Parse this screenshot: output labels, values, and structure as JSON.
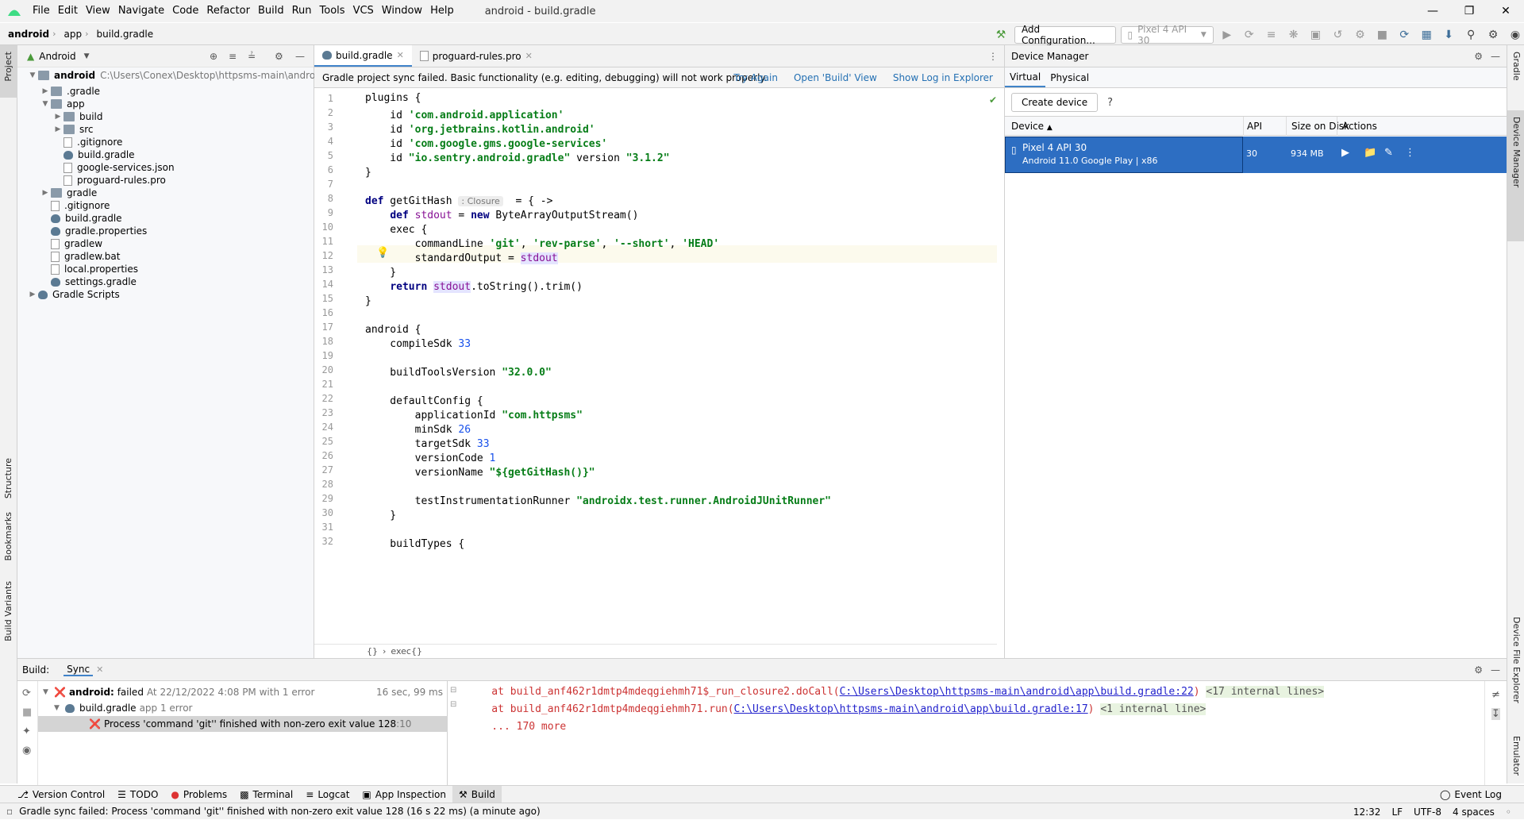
{
  "menubar": {
    "items": [
      "File",
      "Edit",
      "View",
      "Navigate",
      "Code",
      "Refactor",
      "Build",
      "Run",
      "Tools",
      "VCS",
      "Window",
      "Help"
    ],
    "window_title": "android - build.gradle"
  },
  "navbar": {
    "crumbs": [
      "android",
      "app",
      "build.gradle"
    ],
    "add_config": "Add Configuration...",
    "device_selector": "Pixel 4 API 30"
  },
  "project": {
    "view_label": "Android",
    "root_name": "android",
    "root_path": "C:\\Users\\Conex\\Desktop\\httpsms-main\\android",
    "items": [
      ".gradle",
      "app",
      "build",
      "src",
      ".gitignore",
      "build.gradle",
      "google-services.json",
      "proguard-rules.pro",
      "gradle",
      ".gitignore",
      "build.gradle",
      "gradle.properties",
      "gradlew",
      "gradlew.bat",
      "local.properties",
      "settings.gradle",
      "Gradle Scripts"
    ]
  },
  "left_strip": {
    "project": "Project",
    "structure": "Structure",
    "bookmarks": "Bookmarks",
    "build_variants": "Build Variants"
  },
  "right_strip": {
    "gradle": "Gradle",
    "device_manager": "Device Manager",
    "device_file_explorer": "Device File Explorer",
    "emulator": "Emulator"
  },
  "editor": {
    "tabs": [
      "build.gradle",
      "proguard-rules.pro"
    ],
    "banner": {
      "message": "Gradle project sync failed. Basic functionality (e.g. editing, debugging) will not work properly.",
      "try_again": "Try Again",
      "open_build": "Open 'Build' View",
      "show_log": "Show Log in Explorer"
    },
    "line_numbers": [
      "1",
      "2",
      "3",
      "4",
      "5",
      "6",
      "7",
      "8",
      "9",
      "10",
      "11",
      "12",
      "13",
      "14",
      "15",
      "16",
      "17",
      "18",
      "19",
      "20",
      "21",
      "22",
      "23",
      "24",
      "25",
      "26",
      "27",
      "28",
      "29",
      "30",
      "31",
      "32"
    ],
    "closure_hint": ": Closure",
    "breadcrumb": [
      "{}",
      "exec{}"
    ]
  },
  "device_manager": {
    "title": "Device Manager",
    "tabs": [
      "Virtual",
      "Physical"
    ],
    "create_device": "Create device",
    "help": "?",
    "columns": [
      "Device",
      "API",
      "Size on Disk",
      "Actions"
    ],
    "device": {
      "name": "Pixel 4 API 30",
      "details": "Android 11.0 Google Play | x86",
      "api": "30",
      "size": "934 MB"
    }
  },
  "build": {
    "label": "Build:",
    "tab": "Sync",
    "tree": {
      "root_name": "android:",
      "root_status": "failed",
      "root_detail": "At 22/12/2022 4:08 PM with 1 error",
      "root_time": "16 sec, 99 ms",
      "child_name": "build.gradle",
      "child_detail": "app 1 error",
      "error_text": "Process 'command 'git'' finished with non-zero exit value 128",
      "error_loc": ":10"
    },
    "console": {
      "line1_pre": "    at build_anf462r1dmtp4mdeqgiehmh71$_run_closure2.doCall(",
      "line1_link": "C:\\Users\\Desktop\\httpsms-main\\android\\app\\build.gradle:22",
      "line1_post": ") ",
      "line1_internal": "<17 internal lines>",
      "line2_pre": "    at build_anf462r1dmtp4mdeqgiehmh71.run(",
      "line2_link": "C:\\Users\\Desktop\\httpsms-main\\android\\app\\build.gradle:17",
      "line2_post": ") ",
      "line2_internal": "<1 internal line>",
      "line3": "    ... 170 more"
    }
  },
  "toolwindows": [
    "Version Control",
    "TODO",
    "Problems",
    "Terminal",
    "Logcat",
    "App Inspection",
    "Build"
  ],
  "event_log": "Event Log",
  "status": {
    "message": "Gradle sync failed: Process 'command 'git'' finished with non-zero exit value 128 (16 s 22 ms) (a minute ago)",
    "position": "12:32",
    "line_sep": "LF",
    "encoding": "UTF-8",
    "indent": "4 spaces"
  },
  "colors": {
    "accent": "#2d6ec2",
    "error": "#d33",
    "link": "#2470b3"
  }
}
